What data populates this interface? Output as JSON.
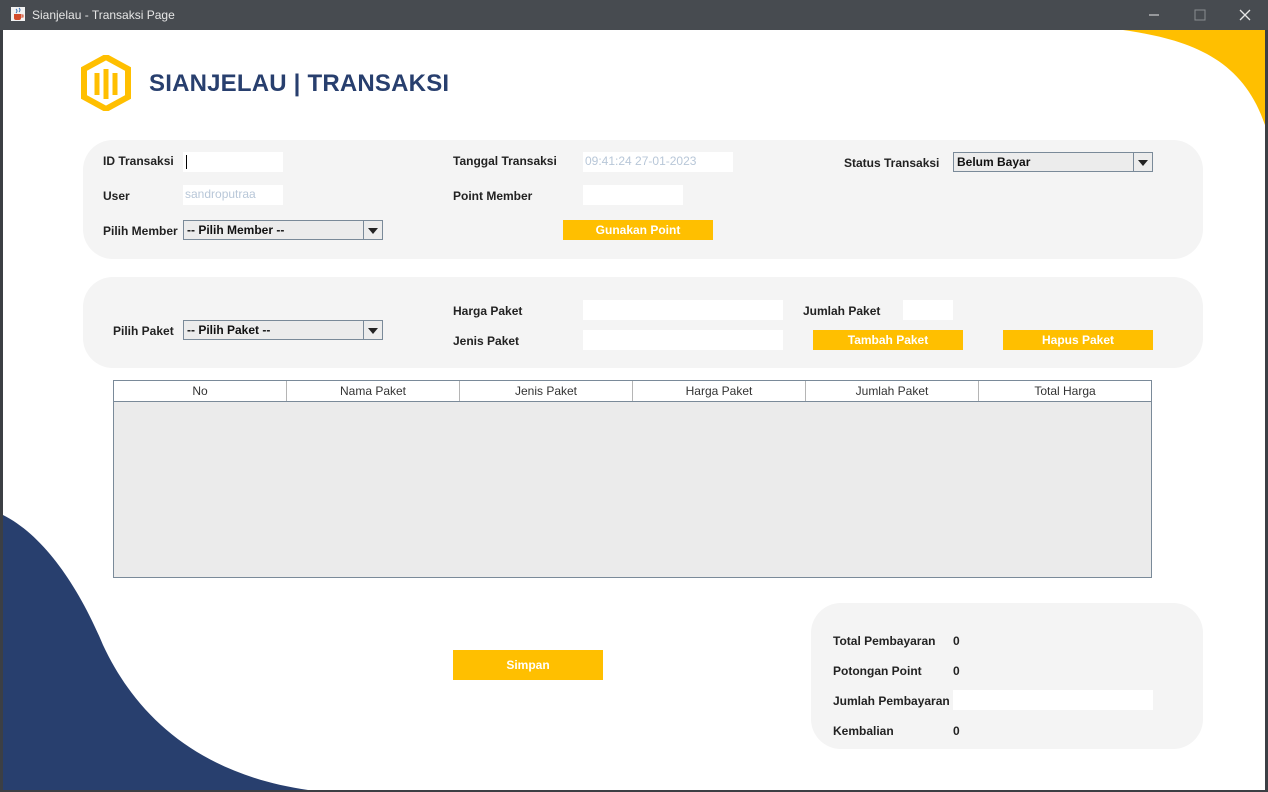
{
  "window": {
    "title": "Sianjelau - Transaksi Page"
  },
  "brand": {
    "title": "SIANJELAU | TRANSAKSI"
  },
  "colors": {
    "accent": "#ffbf00",
    "navy": "#283f6e",
    "panel": "#f4f4f4"
  },
  "icons": {
    "app": "java-cup-icon",
    "logo": "hexagon-logo-icon"
  },
  "form": {
    "id_transaksi_label": "ID Transaksi",
    "id_transaksi_value": "",
    "user_label": "User",
    "user_value": "sandroputraa",
    "pilih_member_label": "Pilih Member",
    "pilih_member_value": "-- Pilih Member --",
    "tanggal_label": "Tanggal Transaksi",
    "tanggal_value": "09:41:24 27-01-2023",
    "point_member_label": "Point Member",
    "point_member_value": "",
    "gunakan_point_label": "Gunakan Point",
    "status_label": "Status Transaksi",
    "status_value": "Belum Bayar"
  },
  "paket": {
    "pilih_paket_label": "Pilih Paket",
    "pilih_paket_value": "-- Pilih Paket --",
    "harga_label": "Harga Paket",
    "harga_value": "",
    "jenis_label": "Jenis Paket",
    "jenis_value": "",
    "jumlah_label": "Jumlah Paket",
    "jumlah_value": "",
    "tambah_label": "Tambah Paket",
    "hapus_label": "Hapus Paket"
  },
  "table": {
    "columns": [
      "No",
      "Nama Paket",
      "Jenis Paket",
      "Harga Paket",
      "Jumlah Paket",
      "Total Harga"
    ],
    "rows": []
  },
  "simpan_label": "Simpan",
  "summary": {
    "total_label": "Total Pembayaran",
    "total_value": "0",
    "potongan_label": "Potongan Point",
    "potongan_value": "0",
    "jumlah_label": "Jumlah Pembayaran",
    "jumlah_value": "",
    "kembalian_label": "Kembalian",
    "kembalian_value": "0"
  }
}
